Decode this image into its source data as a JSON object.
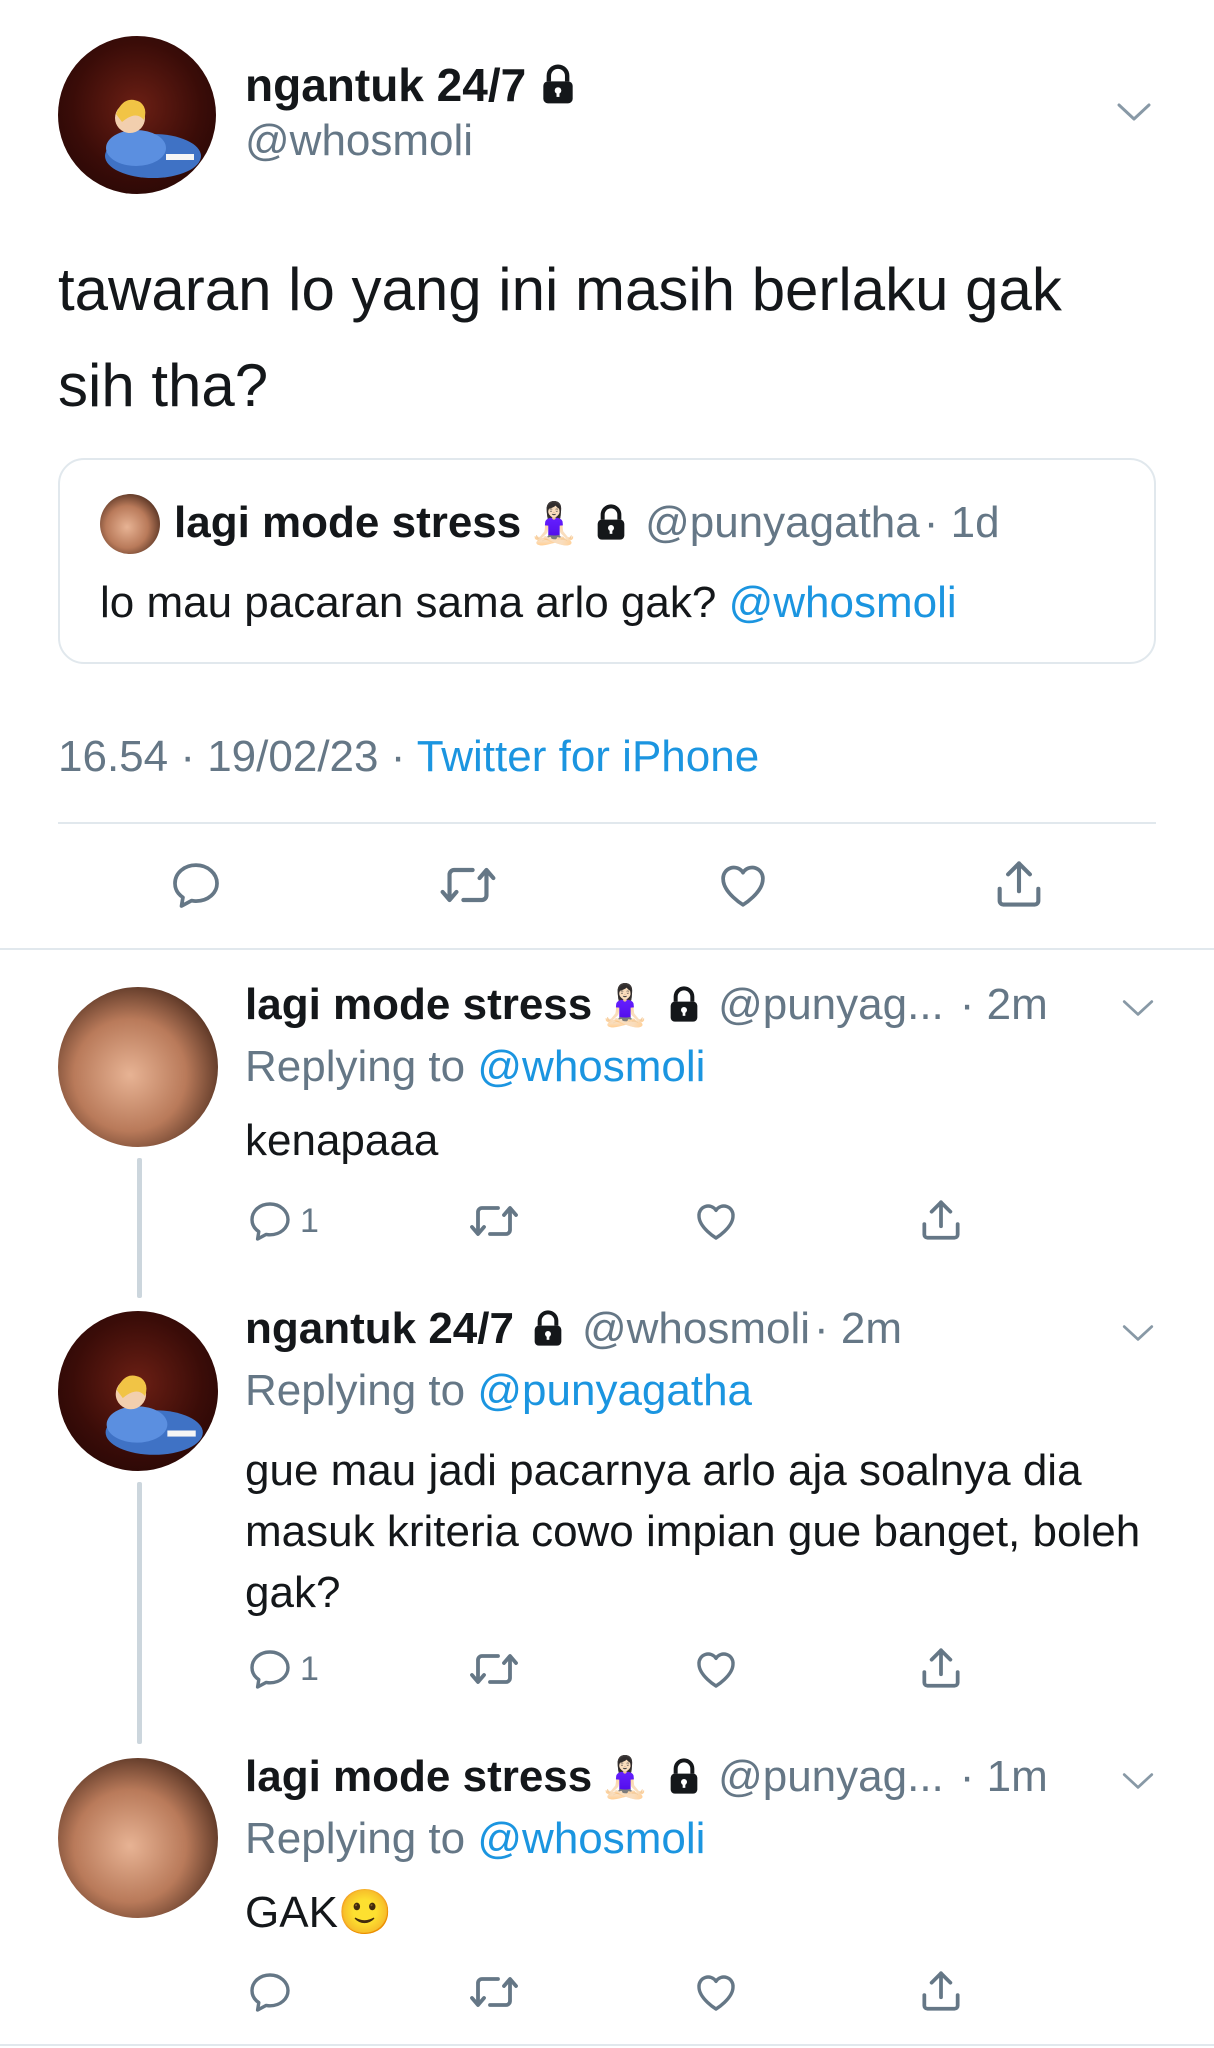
{
  "main_tweet": {
    "display_name": "ngantuk 24/7",
    "handle": "@whosmoli",
    "text": "tawaran lo yang ini masih berlaku gak sih tha?",
    "quote": {
      "display_name": "lagi mode stress",
      "emoji": "🧘🏻‍♀️",
      "handle": "@punyagatha",
      "time": "· 1d",
      "text": "lo mau pacaran sama arlo gak?",
      "mention": "@whosmoli"
    },
    "meta_time": "16.54 · 19/02/23 ·",
    "source": "Twitter for iPhone"
  },
  "replies": [
    {
      "display_name": "lagi mode stress",
      "emoji": "🧘🏻‍♀️",
      "handle": "@punyag...",
      "time": "· 2m",
      "replying_label": "Replying to",
      "replying_to": "@whosmoli",
      "text": "kenapaaa",
      "reply_count": "1"
    },
    {
      "display_name": "ngantuk 24/7",
      "handle": "@whosmoli",
      "time": "· 2m",
      "replying_label": "Replying to",
      "replying_to": "@punyagatha",
      "text": "gue mau jadi pacarnya arlo aja soalnya dia masuk kriteria cowo impian gue banget, boleh gak?",
      "reply_count": "1"
    },
    {
      "display_name": "lagi mode stress",
      "emoji": "🧘🏻‍♀️",
      "handle": "@punyag...",
      "time": "· 1m",
      "replying_label": "Replying to",
      "replying_to": "@whosmoli",
      "text": "GAK",
      "text_emoji": "🙂",
      "reply_count": ""
    }
  ],
  "icons": [
    "chevron-down-icon",
    "lock-icon",
    "reply-icon",
    "retweet-icon",
    "like-icon",
    "share-icon"
  ],
  "colors": {
    "link": "#1b95e0",
    "secondary": "#657786",
    "border": "#e1e8ed",
    "text": "#14171a"
  }
}
